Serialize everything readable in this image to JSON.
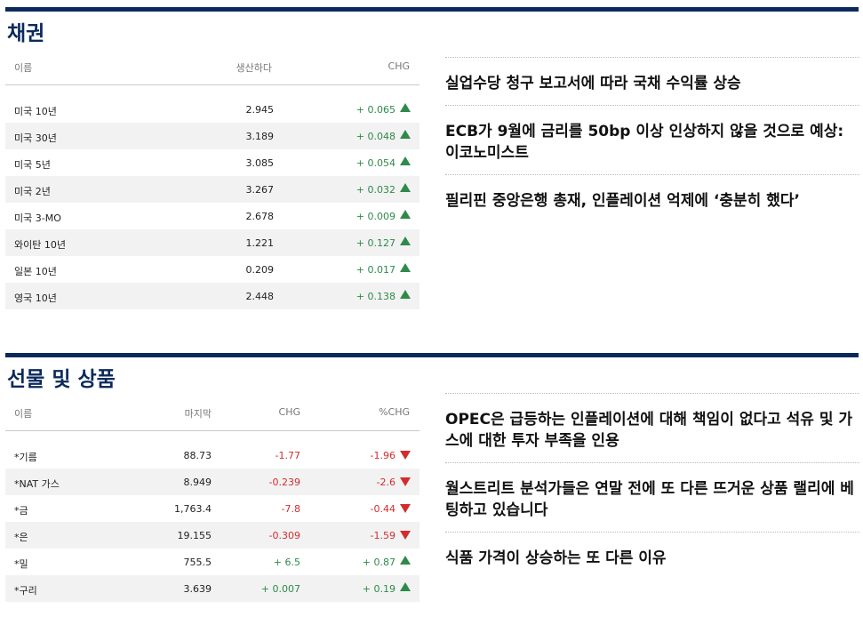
{
  "bonds": {
    "title": "채권",
    "headers": {
      "name": "이름",
      "yield": "생산하다",
      "chg": "CHG"
    },
    "rows": [
      {
        "name": "미국 10년",
        "yield": "2.945",
        "chg": "+ 0.065"
      },
      {
        "name": "미국 30년",
        "yield": "3.189",
        "chg": "+ 0.048"
      },
      {
        "name": "미국 5년",
        "yield": "3.085",
        "chg": "+ 0.054"
      },
      {
        "name": "미국 2년",
        "yield": "3.267",
        "chg": "+ 0.032"
      },
      {
        "name": "미국 3-MO",
        "yield": "2.678",
        "chg": "+ 0.009"
      },
      {
        "name": "와이탄 10년",
        "yield": "1.221",
        "chg": "+ 0.127"
      },
      {
        "name": "일본 10년",
        "yield": "0.209",
        "chg": "+ 0.017"
      },
      {
        "name": "영국 10년",
        "yield": "2.448",
        "chg": "+ 0.138"
      }
    ],
    "news": [
      "실업수당 청구 보고서에 따라 국채 수익률 상승",
      "ECB가 9월에 금리를 50bp 이상 인상하지 않을 것으로 예상: 이코노미스트",
      "필리핀 중앙은행 총재, 인플레이션 억제에 ‘충분히 했다’"
    ]
  },
  "futures": {
    "title": "선물 및 상품",
    "headers": {
      "name": "이름",
      "last": "마지막",
      "chg": "CHG",
      "pct": "%CHG"
    },
    "rows": [
      {
        "name": "*기름",
        "last": "88.73",
        "chg": "-1.77",
        "pct": "-1.96",
        "dir": "down"
      },
      {
        "name": "*NAT 가스",
        "last": "8.949",
        "chg": "-0.239",
        "pct": "-2.6",
        "dir": "down"
      },
      {
        "name": "*금",
        "last": "1,763.4",
        "chg": "-7.8",
        "pct": "-0.44",
        "dir": "down"
      },
      {
        "name": "*은",
        "last": "19.155",
        "chg": "-0.309",
        "pct": "-1.59",
        "dir": "down"
      },
      {
        "name": "*밀",
        "last": "755.5",
        "chg": "+ 6.5",
        "pct": "+ 0.87",
        "dir": "up"
      },
      {
        "name": "*구리",
        "last": "3.639",
        "chg": "+ 0.007",
        "pct": "+ 0.19",
        "dir": "up"
      }
    ],
    "news": [
      "OPEC은 급등하는 인플레이션에 대해 책임이 없다고 석유 및 가스에 대한 투자 부족을 인용",
      "월스트리트 분석가들은 연말 전에 또 다른 뜨거운 상품 랠리에 베팅하고 있습니다",
      "식품 가격이 상승하는 또 다른 이유"
    ]
  },
  "colors": {
    "brand": "#0b2a5b",
    "up": "#2e8a4a",
    "down": "#d22d2d"
  },
  "icons": {
    "up": "triangle-up-icon",
    "down": "triangle-down-icon"
  }
}
